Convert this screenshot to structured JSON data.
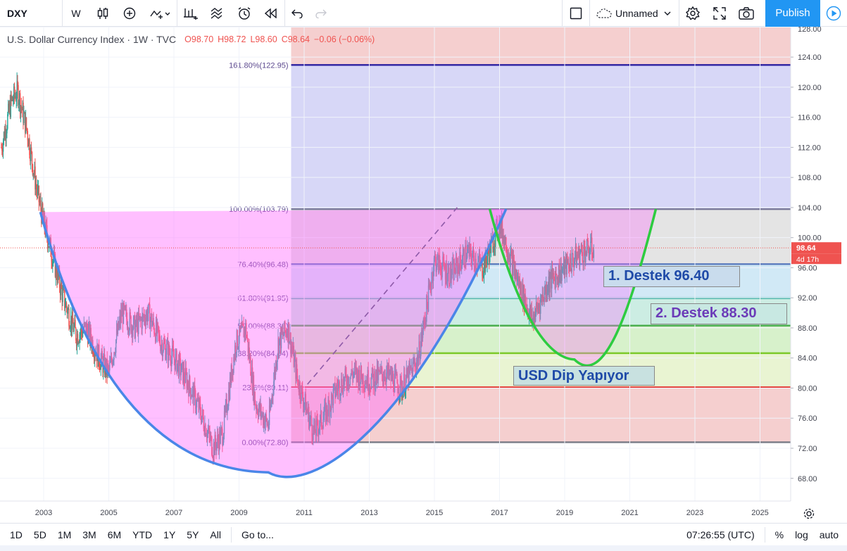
{
  "toolbar": {
    "symbol": "DXY",
    "interval": "W",
    "layout_name": "Unnamed",
    "publish_label": "Publish"
  },
  "legend": {
    "title": "U.S. Dollar Currency Index · 1W · TVC",
    "open": "O98.70",
    "high": "H98.72",
    "low": "L98.60",
    "close": "C98.64",
    "change": "−0.06 (−0.06%)"
  },
  "price_labels": {
    "last": "98.64",
    "countdown": "4d 17h"
  },
  "annotations": {
    "support1": "1. Destek 96.40",
    "support2": "2. Destek 88.30",
    "dip": "USD Dip Yapıyor"
  },
  "bottombar": {
    "ranges": [
      "1D",
      "5D",
      "1M",
      "3M",
      "6M",
      "YTD",
      "1Y",
      "5Y",
      "All"
    ],
    "goto": "Go to...",
    "time": "07:26:55 (UTC)",
    "pct": "%",
    "log": "log",
    "auto": "auto"
  },
  "colors": {
    "accent": "#2196f3",
    "up": "#26a69a",
    "down": "#ef5350",
    "cup_curve": "#4a86e8",
    "second_curve": "#2ecc40"
  },
  "chart_data": {
    "type": "line",
    "symbol": "DXY",
    "y_ticks": [
      128,
      124,
      120,
      116,
      112,
      108,
      104,
      100,
      96,
      92,
      88,
      84,
      80,
      76,
      72,
      68
    ],
    "x_ticks": [
      2003,
      2005,
      2007,
      2009,
      2011,
      2013,
      2015,
      2017,
      2019,
      2021,
      2023,
      2025
    ],
    "ylim": [
      65,
      129
    ],
    "xlim": [
      2001.7,
      2026.0
    ],
    "fib_start_year": 2010.6,
    "fib_end_year": 2026.0,
    "fib_levels": [
      {
        "label": "0.00%(72.80)",
        "value": 72.8,
        "line_color": "#787b86",
        "fill": "#f4cccc"
      },
      {
        "label": "23.6%(80.11)",
        "value": 80.11,
        "line_color": "#e53935",
        "fill": "#e8f3d0"
      },
      {
        "label": "38.20%(84.64)",
        "value": 84.64,
        "line_color": "#7cc92a",
        "fill": "#d5f0c8"
      },
      {
        "label": "50.00%(88.30)",
        "value": 88.3,
        "line_color": "#4caf50",
        "fill": "#c9ece1"
      },
      {
        "label": "61.80%(91.95)",
        "value": 91.95,
        "line_color": "#26a69a",
        "fill": "#cfe8f5"
      },
      {
        "label": "76.40%(96.48)",
        "value": 96.48,
        "line_color": "#5b7bbd",
        "fill": "#e3e3e3"
      },
      {
        "label": "100.00%(103.79)",
        "value": 103.79,
        "line_color": "#7a7a9a",
        "fill": "#d5d5f7"
      },
      {
        "label": "161.80%(122.95)",
        "value": 122.95,
        "line_color": "#2b1fa0",
        "fill": "#f4cccc"
      }
    ],
    "series": [
      {
        "x": [
          2001.7,
          2002.0,
          2002.2,
          2002.5,
          2002.8,
          2003.0,
          2003.3,
          2003.6,
          2004.0,
          2004.3,
          2004.7,
          2005.0,
          2005.4,
          2005.8,
          2006.2,
          2006.6,
          2007.0,
          2007.4,
          2007.8,
          2008.2,
          2008.5,
          2008.9,
          2009.2,
          2009.5,
          2009.9,
          2010.2,
          2010.5,
          2010.8,
          2011.3,
          2011.7,
          2012.0,
          2012.5,
          2013.0,
          2013.5,
          2014.0,
          2014.5,
          2015.0,
          2015.5,
          2016.0,
          2016.5,
          2017.0,
          2017.5,
          2018.0,
          2018.5,
          2019.0,
          2019.5,
          2019.9
        ],
        "values": [
          112,
          118,
          119.5,
          114,
          106,
          102,
          97,
          92,
          87,
          88,
          84,
          82,
          90,
          88,
          90,
          86,
          84,
          81,
          77,
          72,
          74,
          86,
          88,
          78,
          75,
          86,
          88,
          81,
          74,
          77,
          80,
          82,
          81,
          82,
          80,
          84,
          97,
          95,
          98,
          96,
          102,
          95,
          89,
          94,
          96,
          98,
          98.6
        ]
      }
    ]
  }
}
